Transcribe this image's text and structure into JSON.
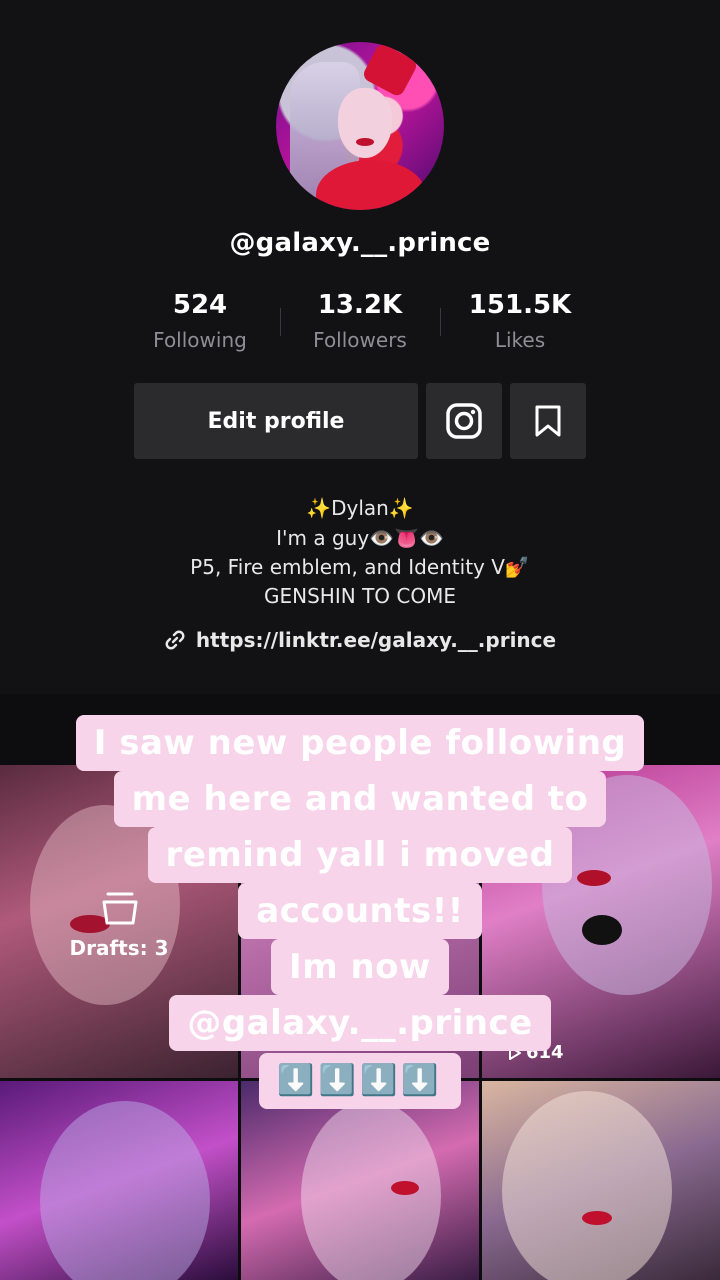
{
  "profile": {
    "username": "@galaxy.__.prince",
    "stats": {
      "following": {
        "value": "524",
        "label": "Following"
      },
      "followers": {
        "value": "13.2K",
        "label": "Followers"
      },
      "likes": {
        "value": "151.5K",
        "label": "Likes"
      }
    },
    "edit_button": "Edit profile",
    "icons": {
      "instagram": "instagram-icon",
      "bookmark": "bookmark-icon",
      "link": "link-icon"
    },
    "bio": [
      "✨Dylan✨",
      "I'm a guy👁️👅👁️",
      "P5, Fire emblem, and Identity V💅",
      "GENSHIN TO COME"
    ],
    "link": "https://linktr.ee/galaxy.__.prince"
  },
  "grid": {
    "drafts_label": "Drafts: 3",
    "tile3_views": "614"
  },
  "overlay": {
    "lines": [
      "I saw new people following",
      "me here and wanted to",
      "remind yall i moved",
      "accounts!!",
      "Im now",
      "@galaxy.__.prince",
      "⬇️⬇️⬇️⬇️"
    ],
    "bg_color": "#f7d4ea"
  }
}
